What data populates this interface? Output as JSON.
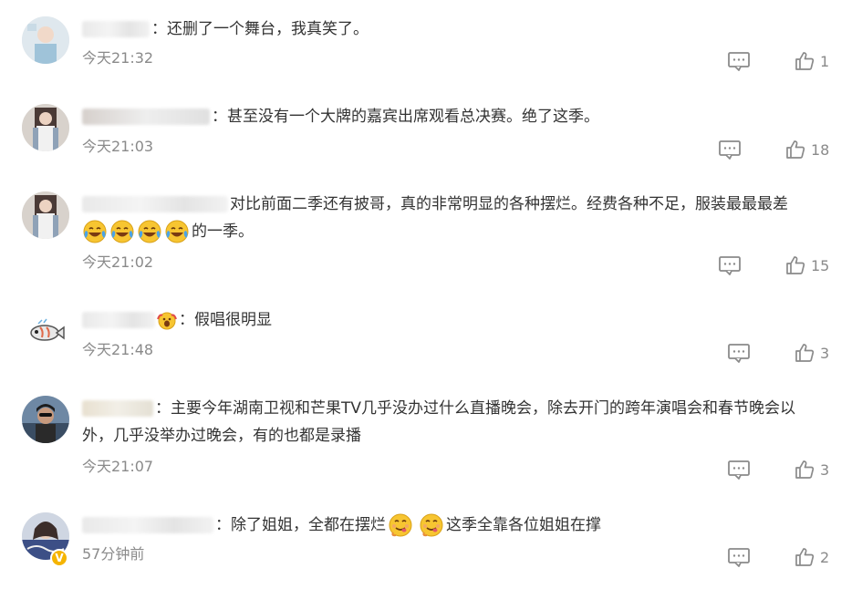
{
  "comments": [
    {
      "text": "：还删了一个舞台，我真笑了。",
      "time": "今天21:32",
      "likes": "1"
    },
    {
      "text": "：甚至没有一个大牌的嘉宾出席观看总决赛。绝了这季。",
      "time": "今天21:03",
      "likes": "18"
    },
    {
      "text_line1": "对比前面二季还有披哥，真的非常明显的各种摆烂。经费各种不足，服装最最最差",
      "text_line2": "的一季。",
      "time": "今天21:02",
      "likes": "15"
    },
    {
      "text": "假唱很明显",
      "time": "今天21:48",
      "likes": "3"
    },
    {
      "text_line1": "：主要今年湖南卫视和芒果TV几乎没办过什么直播晚会，除去开门的跨年演唱会和春节晚会以",
      "text_line2": "外，几乎没举办过晚会，有的也都是录播",
      "time": "今天21:07",
      "likes": "3"
    },
    {
      "text_a": "：除了姐姐，全都在摆烂",
      "text_b": "这季全靠各位姐姐在撑",
      "time": "57分钟前",
      "likes": "2",
      "verified_mark": "V"
    }
  ],
  "icons": {
    "reply": "comment-icon",
    "like": "thumbs-up-icon",
    "emoji_laugh_cry": "laughing-crying-emoji",
    "emoji_yum": "yum-emoji",
    "emoji_scream": "scream-emoji"
  },
  "colors": {
    "time": "#8a8a8a",
    "text": "#333333",
    "icon": "#8a8a8a",
    "verified": "#f5b400"
  }
}
